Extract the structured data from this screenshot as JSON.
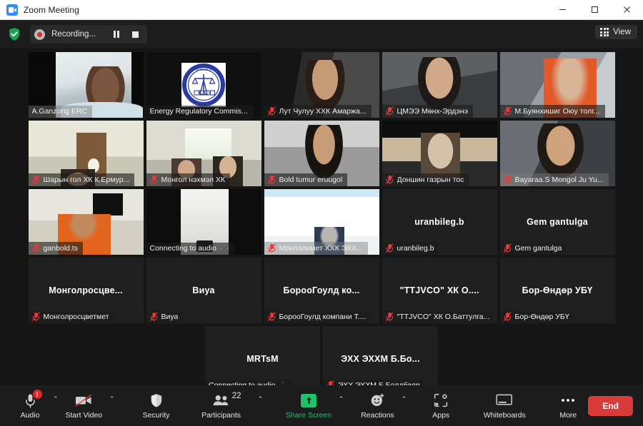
{
  "window": {
    "title": "Zoom Meeting",
    "app_icon": "zoom-camera-icon",
    "minimize": "—",
    "maximize": "□",
    "close": "✕"
  },
  "recording": {
    "shield_icon": "security-shield-icon",
    "record_dot_icon": "record-dot-icon",
    "label": "Recording...",
    "pause_icon": "pause-icon",
    "stop_icon": "stop-icon"
  },
  "view": {
    "label": "View",
    "icon": "grid-view-icon"
  },
  "gallery": {
    "rows": [
      [
        {
          "name": "A.Ganzorig ERC",
          "display": "",
          "type": "video",
          "video": "v1",
          "active": true,
          "muted": false,
          "namebar": "solid"
        },
        {
          "name": "Energy Regulatory Commis...",
          "display": "",
          "type": "logo",
          "video": "vlogo",
          "active": false,
          "muted": false,
          "namebar": "plain"
        },
        {
          "name": "Лут Чулуу ХХК Амаржа...",
          "display": "",
          "type": "video",
          "video": "v3",
          "active": false,
          "muted": true,
          "namebar": "plain"
        },
        {
          "name": "ЦМЭЭ Мөнх-Эрдэнэ",
          "display": "",
          "type": "video",
          "video": "v4",
          "active": false,
          "muted": true,
          "namebar": "plain"
        },
        {
          "name": "М.Буянхишиг Оюу толг...",
          "display": "",
          "type": "video",
          "video": "v5",
          "active": false,
          "muted": true,
          "namebar": "plain"
        }
      ],
      [
        {
          "name": "Шарын гол ХК К.Ермур...",
          "display": "",
          "type": "video",
          "video": "v6",
          "active": false,
          "muted": true,
          "namebar": "plain"
        },
        {
          "name": "Монгол нэхмэл ХК",
          "display": "",
          "type": "video",
          "video": "v7",
          "active": false,
          "muted": true,
          "namebar": "plain"
        },
        {
          "name": "Bold tumur eruugol",
          "display": "",
          "type": "video",
          "video": "v8",
          "active": false,
          "muted": true,
          "namebar": "plain"
        },
        {
          "name": "Доншин газрын тос",
          "display": "",
          "type": "video",
          "video": "v9",
          "active": false,
          "muted": true,
          "namebar": "plain"
        },
        {
          "name": "Bayaraa.S Mongol Ju Yu...",
          "display": "",
          "type": "video",
          "video": "v10",
          "active": false,
          "muted": true,
          "namebar": "solid"
        }
      ],
      [
        {
          "name": "ganbold.ts",
          "display": "",
          "type": "video",
          "video": "v11",
          "active": false,
          "muted": true,
          "namebar": "plain"
        },
        {
          "name": "Connecting to audio",
          "display": "",
          "type": "video",
          "video": "v12",
          "active": false,
          "muted": false,
          "namebar": "plain",
          "connecting": true
        },
        {
          "name": "Монполимет ХХК  ЭХХ...",
          "display": "",
          "type": "video",
          "video": "v13",
          "active": false,
          "muted": true,
          "namebar": "solid"
        },
        {
          "name": "uranbileg.b",
          "display": "uranbileg.b",
          "type": "name",
          "video": "",
          "active": false,
          "muted": true,
          "namebar": "plain"
        },
        {
          "name": "Gem gantulga",
          "display": "Gem gantulga",
          "type": "name",
          "video": "",
          "active": false,
          "muted": true,
          "namebar": "plain"
        }
      ],
      [
        {
          "name": "Монголросцветмет",
          "display": "Монголросцве...",
          "type": "name",
          "video": "",
          "active": false,
          "muted": true,
          "namebar": "plain"
        },
        {
          "name": "Виуа",
          "display": "Виуа",
          "type": "name",
          "video": "",
          "active": false,
          "muted": true,
          "namebar": "plain"
        },
        {
          "name": "БорооГоулд компани Т....",
          "display": "БорооГоулд  ко...",
          "type": "name",
          "video": "",
          "active": false,
          "muted": true,
          "namebar": "plain"
        },
        {
          "name": "\"TTJVCO\" ХК О.Баттулга...",
          "display": "\"TTJVCO\"  ХК  О....",
          "type": "name",
          "video": "",
          "active": false,
          "muted": true,
          "namebar": "plain"
        },
        {
          "name": "Бор-Өндөр УБҮ",
          "display": "Бор-Өндөр УБҮ",
          "type": "name",
          "video": "",
          "active": false,
          "muted": true,
          "namebar": "plain"
        }
      ],
      [
        {
          "name": "Connecting to audio",
          "display": "MRTsM",
          "type": "name",
          "video": "",
          "active": false,
          "muted": false,
          "namebar": "plain",
          "connecting": true
        },
        {
          "name": "ЭХХ ЭХХМ Б.Болдбаяр",
          "display": "ЭХХ ЭХХМ Б.Бо...",
          "type": "name",
          "video": "",
          "active": false,
          "muted": true,
          "namebar": "plain"
        }
      ]
    ]
  },
  "toolbar": {
    "audio": {
      "label": "Audio",
      "icon": "microphone-muted-icon",
      "badge": "!"
    },
    "video": {
      "label": "Start Video",
      "icon": "video-off-icon"
    },
    "security": {
      "label": "Security",
      "icon": "shield-icon"
    },
    "participants": {
      "label": "Participants",
      "icon": "participants-icon",
      "count": "22"
    },
    "share": {
      "label": "Share Screen",
      "icon": "share-screen-arrow-icon"
    },
    "reactions": {
      "label": "Reactions",
      "icon": "reactions-smiley-icon"
    },
    "apps": {
      "label": "Apps",
      "icon": "apps-icon"
    },
    "whiteboards": {
      "label": "Whiteboards",
      "icon": "whiteboard-icon"
    },
    "more": {
      "label": "More",
      "icon": "more-dots-icon"
    },
    "end": {
      "label": "End"
    },
    "caret": "⌃"
  },
  "colors": {
    "accent_green": "#21c06b",
    "end_red": "#d93b3b",
    "active_border": "#d9e553",
    "badge_red": "#e02828"
  }
}
